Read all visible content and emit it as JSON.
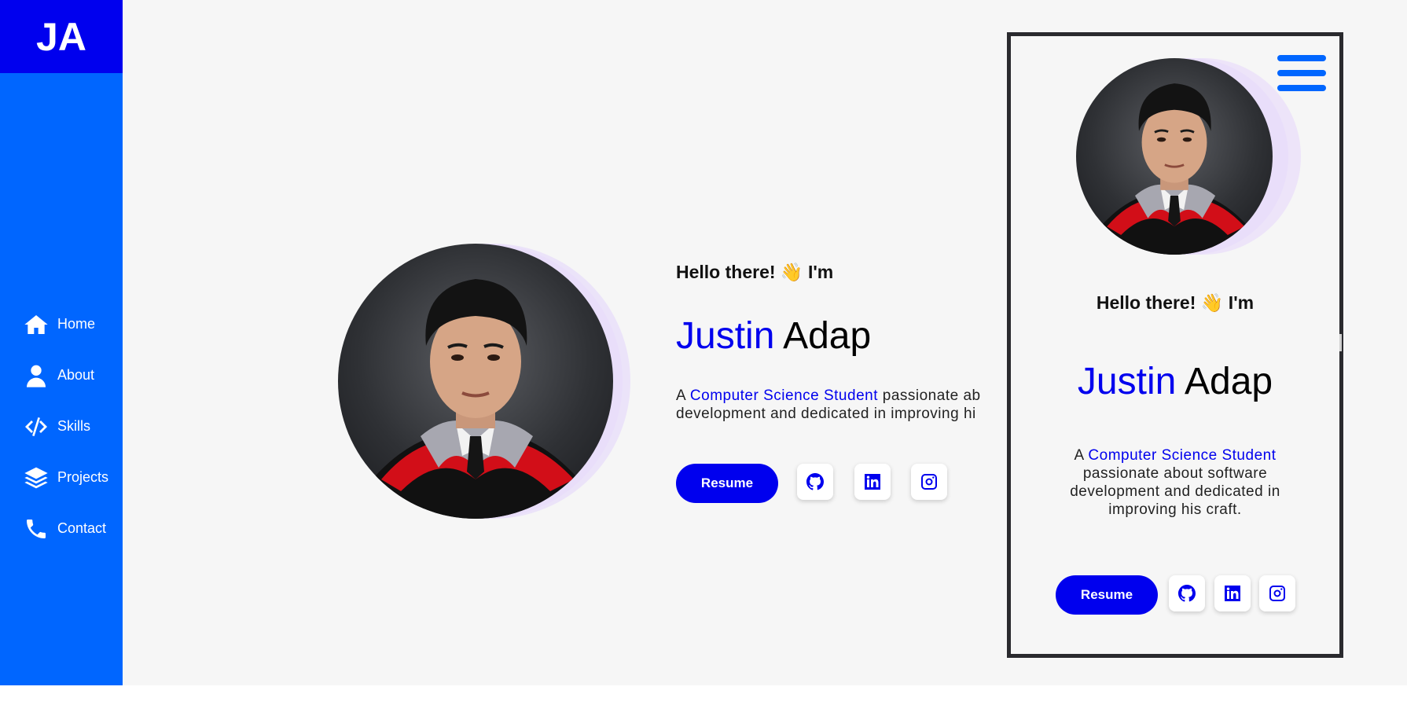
{
  "sidebar": {
    "logo": "JA",
    "items": [
      {
        "label": "Home",
        "icon": "home-icon"
      },
      {
        "label": "About",
        "icon": "user-icon"
      },
      {
        "label": "Skills",
        "icon": "code-icon"
      },
      {
        "label": "Projects",
        "icon": "layers-icon"
      },
      {
        "label": "Contact",
        "icon": "phone-icon"
      }
    ]
  },
  "hero": {
    "greeting": "Hello there! 👋 I'm",
    "first_name": "Justin",
    "last_name": "Adap",
    "desc_prefix": "A ",
    "desc_highlight": "Computer Science Student",
    "desc_rest_line1": " passionate ab",
    "desc_line2": "development and dedicated in improving hi",
    "resume_label": "Resume"
  },
  "mobile": {
    "greeting": "Hello there! 👋 I'm",
    "first_name": "Justin",
    "last_name": "Adap",
    "desc_prefix": "A ",
    "desc_highlight": "Computer Science Student",
    "desc_rest": "passionate about software development and dedicated in improving his craft.",
    "resume_label": "Resume"
  },
  "social_links": [
    "github-icon",
    "linkedin-icon",
    "instagram-icon"
  ],
  "colors": {
    "accent": "#0000ee",
    "sidebar": "#0066ff",
    "logo_bg": "#0000ee",
    "background": "#f6f6f6"
  }
}
